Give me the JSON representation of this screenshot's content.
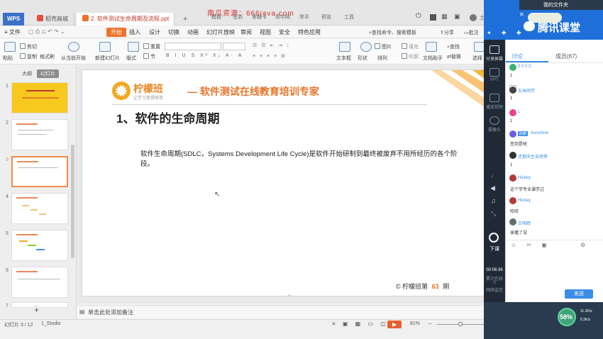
{
  "watermark": "南瓜资源：666java.com",
  "tabs": {
    "wps_label": "WPS",
    "t1": "稻壳商城",
    "t2": "2. 软件测试生命周期及流程.ppt"
  },
  "top_menu": [
    "模板",
    "签到",
    "答题卡",
    "高中网",
    "举手",
    "预览",
    "工具"
  ],
  "user_area": "土豆",
  "menu": [
    "文件",
    "开始",
    "插入",
    "设计",
    "切换",
    "动画",
    "幻灯片放映",
    "审阅",
    "视图",
    "安全",
    "特色应用"
  ],
  "menu_right": {
    "search": "查找命令、搜索模板",
    "share": "分享",
    "comment": "批注"
  },
  "ribbon": {
    "cut": "剪切",
    "copy": "复制",
    "paste": "粘贴",
    "format_painter": "格式刷",
    "from_start": "从当前开始",
    "new_slide": "新建幻灯片",
    "layout": "版式",
    "reset": "重置",
    "section": "节",
    "textbox": "文本框",
    "shape": "形状",
    "arrange": "排列",
    "picture": "图片",
    "fill": "填充",
    "find": "查找",
    "replace": "替换",
    "outline": "轮廓",
    "doc_helper": "文档助手",
    "select": "选择"
  },
  "left_panel": {
    "tab_outline": "大纲",
    "tab_slides": "幻灯片"
  },
  "thumbnails": [
    "1",
    "2",
    "3",
    "4",
    "5",
    "6",
    "7"
  ],
  "slide": {
    "logo_text": "柠檬班",
    "logo_sub": "让学习变得简单",
    "tagline": "— 软件测试在线教育培训专家",
    "heading": "1、软件的生命周期",
    "body": "软件生命周期(SDLC，Systems Development Life Cycle)是软件开始研制到最终被废弃不用所经历的各个阶段。",
    "footer_prefix": "© 柠檬班第",
    "footer_num": "63",
    "footer_suffix": "期"
  },
  "notes_placeholder": "单击此处添加备注",
  "status": {
    "slide_count": "幻灯片 3 / 12",
    "theme": "1_Studio",
    "zoom": "81%"
  },
  "tencent": {
    "title_top": "我的文件夹",
    "brand": "腾讯课堂",
    "left_items": [
      {
        "label": "分享屏幕"
      },
      {
        "label": "PPT"
      },
      {
        "label": "播放视频"
      },
      {
        "label": "摄像头"
      }
    ],
    "hangup": "下课",
    "timer": "00:06:36",
    "timer_sub1": "累计在线",
    "timer_sub2": "0",
    "timer_sub3": "网络监控",
    "chat_tabs": {
      "discussion": "讨论",
      "members": "成员(67)"
    },
    "messages": [
      {
        "name": "0 0 0 C",
        "text": "1"
      },
      {
        "name": "",
        "text": "1"
      },
      {
        "name": "五米同学",
        "text": "1"
      },
      {
        "name": "L",
        "text": "1"
      },
      {
        "name": "Sunshine",
        "text": "签到是啥"
      },
      {
        "name": "还剩天生自然秀",
        "text": "1"
      },
      {
        "name": "Hickey",
        "text": "这个学专业课学过"
      },
      {
        "name": "Hickey",
        "text": "哈哈"
      },
      {
        "name": "王明辉",
        "text": "录播了没"
      }
    ],
    "send": "发送",
    "cpu": "58%",
    "net_up": "11.2K/s",
    "net_down": "5.3K/s"
  },
  "colors": {
    "accent": "#f0702a",
    "wps_blue": "#3b71c6",
    "tencent_blue": "#1e6fd9",
    "slide_orange": "#e8742a"
  }
}
